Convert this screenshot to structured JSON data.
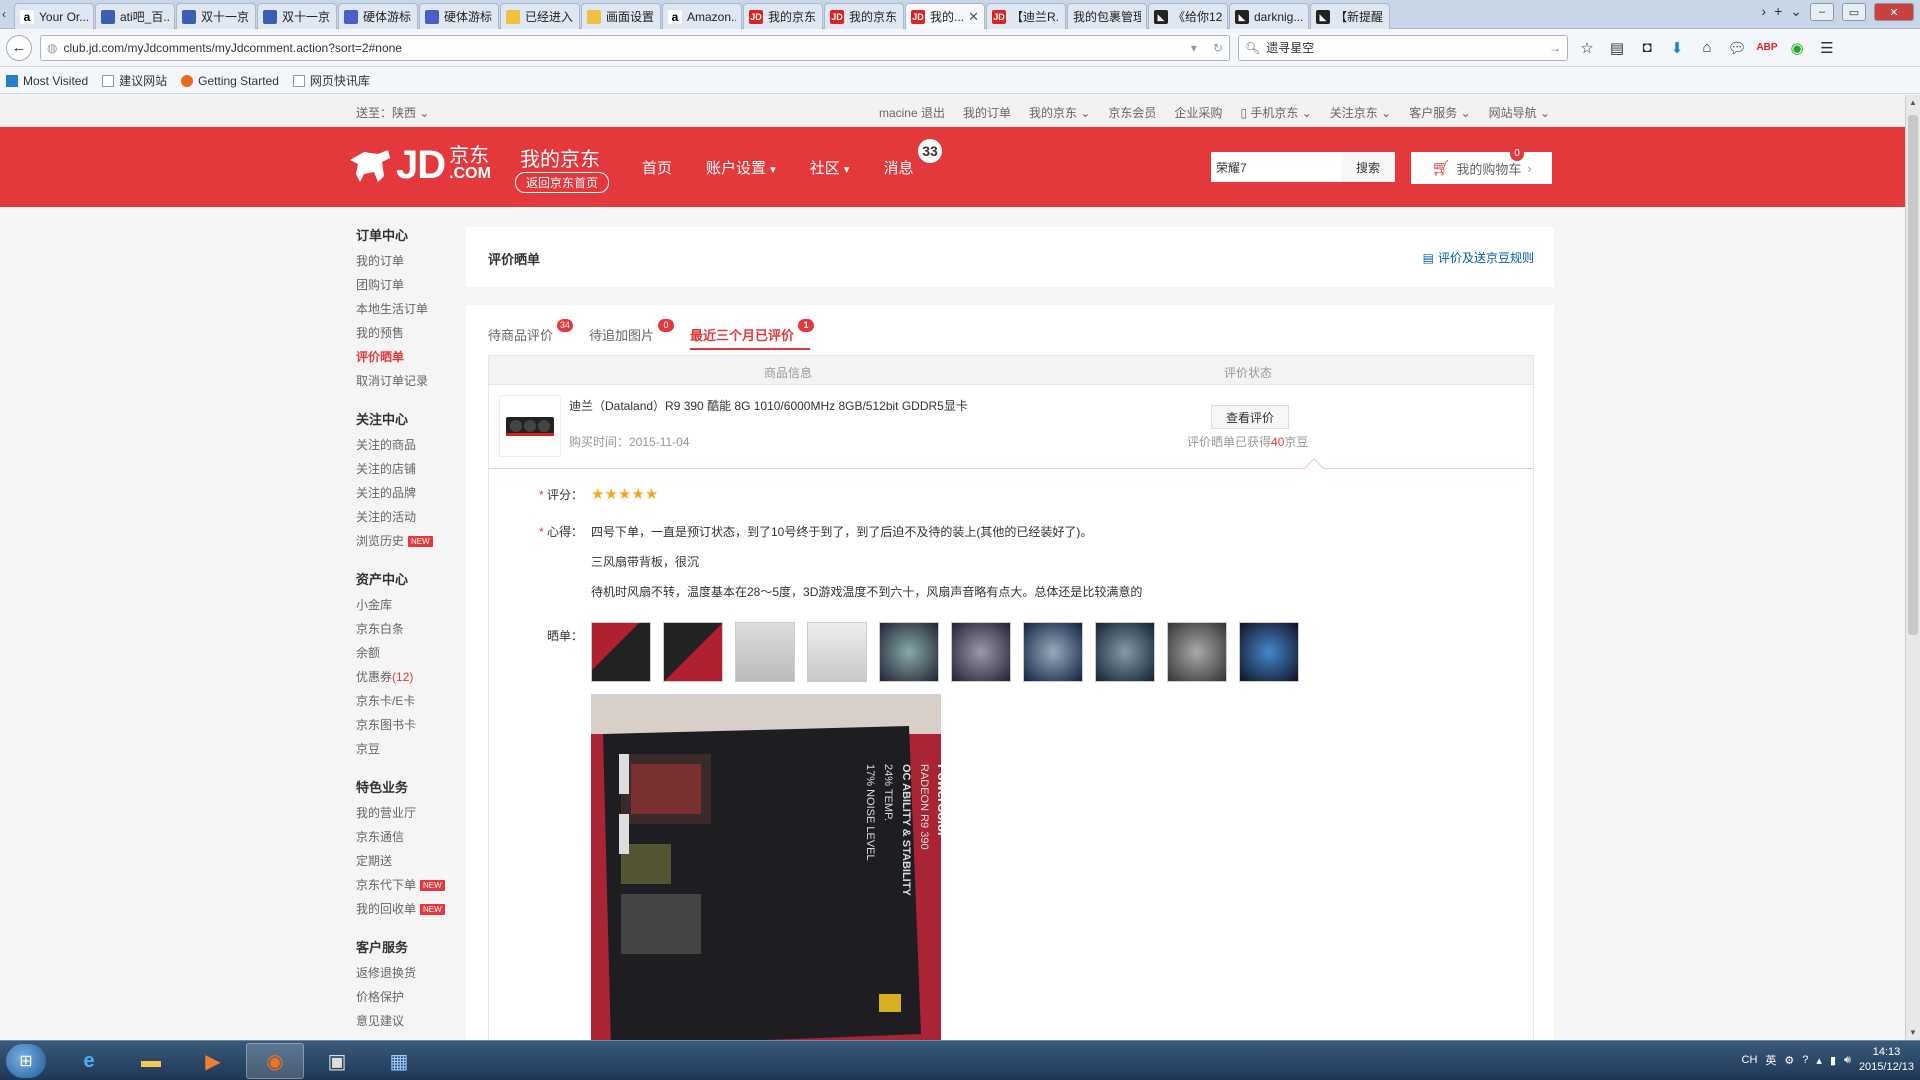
{
  "browser": {
    "tabs": [
      {
        "label": "Your Or...",
        "icon": "amazon-icon"
      },
      {
        "label": "ati吧_百...",
        "icon": "page-icon"
      },
      {
        "label": "双十一京...",
        "icon": "page-icon"
      },
      {
        "label": "双十一京...",
        "icon": "page-icon"
      },
      {
        "label": "硬体游标...",
        "icon": "game-icon"
      },
      {
        "label": "硬体游标...",
        "icon": "game-icon"
      },
      {
        "label": "已经进入...",
        "icon": "folder-icon"
      },
      {
        "label": "画面设置...",
        "icon": "folder-icon"
      },
      {
        "label": "Amazon...",
        "icon": "amazon-icon"
      },
      {
        "label": "我的京东...",
        "icon": "jd-icon"
      },
      {
        "label": "我的京东...",
        "icon": "jd-icon"
      },
      {
        "label": "我的...",
        "icon": "jd-icon",
        "active": true
      },
      {
        "label": "【迪兰R...",
        "icon": "jd-icon"
      },
      {
        "label": "我的包裹管理...",
        "icon": "none"
      },
      {
        "label": "《给你12...",
        "icon": "black-icon"
      },
      {
        "label": "darknig...",
        "icon": "black-icon"
      },
      {
        "label": "【新提醒...",
        "icon": "black-icon"
      }
    ],
    "url": "club.jd.com/myJdcomments/myJdcomment.action?sort=2#none",
    "search_value": "遗寻星空",
    "bookmarks": [
      "Most Visited",
      "建议网站",
      "Getting Started",
      "网页快讯库"
    ]
  },
  "jd": {
    "topbar": {
      "ship_to": "送至：陕西",
      "links": [
        "macine 退出",
        "我的订单",
        "我的京东",
        "京东会员",
        "企业采购",
        "手机京东",
        "关注京东",
        "客户服务",
        "网站导航"
      ]
    },
    "header": {
      "logo_text": "JD",
      "logo_cn": "京东",
      "logo_com": ".COM",
      "title": "我的京东",
      "back_home": "返回京东首页",
      "nav": [
        "首页",
        "账户设置",
        "社区",
        "消息"
      ],
      "message_count": "33",
      "search_value": "荣耀7",
      "search_button": "搜索",
      "cart_label": "我的购物车",
      "cart_count": "0"
    },
    "sidebar": [
      {
        "title": "订单中心",
        "items": [
          {
            "label": "我的订单"
          },
          {
            "label": "团购订单"
          },
          {
            "label": "本地生活订单"
          },
          {
            "label": "我的预售"
          },
          {
            "label": "评价晒单",
            "active": true
          },
          {
            "label": "取消订单记录"
          }
        ]
      },
      {
        "title": "关注中心",
        "items": [
          {
            "label": "关注的商品"
          },
          {
            "label": "关注的店铺"
          },
          {
            "label": "关注的品牌"
          },
          {
            "label": "关注的活动"
          },
          {
            "label": "浏览历史",
            "tag": "NEW"
          }
        ]
      },
      {
        "title": "资产中心",
        "items": [
          {
            "label": "小金库"
          },
          {
            "label": "京东白条"
          },
          {
            "label": "余额"
          },
          {
            "label": "优惠券",
            "count": "(12)"
          },
          {
            "label": "京东卡/E卡"
          },
          {
            "label": "京东图书卡"
          },
          {
            "label": "京豆"
          }
        ]
      },
      {
        "title": "特色业务",
        "items": [
          {
            "label": "我的营业厅"
          },
          {
            "label": "京东通信"
          },
          {
            "label": "定期送"
          },
          {
            "label": "京东代下单",
            "tag": "NEW"
          },
          {
            "label": "我的回收单",
            "tag": "NEW"
          }
        ]
      },
      {
        "title": "客户服务",
        "items": [
          {
            "label": "返修退换货"
          },
          {
            "label": "价格保护"
          },
          {
            "label": "意见建议"
          }
        ]
      }
    ],
    "main": {
      "title": "评价晒单",
      "rules_link": "评价及送京豆规则",
      "tabs": [
        {
          "label": "待商品评价",
          "count": "34"
        },
        {
          "label": "待追加图片",
          "count": "0"
        },
        {
          "label": "最近三个月已评价",
          "count": "1",
          "active": true
        }
      ],
      "columns": [
        "商品信息",
        "评价状态"
      ],
      "product": {
        "name": "迪兰（Dataland）R9 390 酷能 8G 1010/6000MHz 8GB/512bit GDDR5显卡",
        "purchase_date": "购买时间：2015-11-04",
        "view_button": "查看评价",
        "earned_prefix": "评价晒单已获得",
        "earned_beans": "40",
        "earned_suffix": "京豆"
      },
      "review": {
        "rating_label": "评分：",
        "rating": 5,
        "comment_label": "心得：",
        "comment_lines": [
          "四号下单，一直是预订状态，到了10号终于到了，到了后迫不及待的装上(其他的已经装好了)。",
          "三风扇带背板，很沉",
          "待机时风扇不转，温度基本在28～5度，3D游戏温度不到六十，风扇声音略有点大。总体还是比较满意的"
        ],
        "photos_label": "晒单：",
        "photo_count": 10,
        "box_text": [
          "PowerColor",
          "RADEON R9 390",
          "OC ABILITY & STABILITY",
          "24% TEMP.",
          "17% NOISE LEVEL"
        ]
      }
    }
  },
  "taskbar": {
    "ime": "CH",
    "ime_mode": "英",
    "time": "14:13",
    "date": "2015/12/13"
  }
}
